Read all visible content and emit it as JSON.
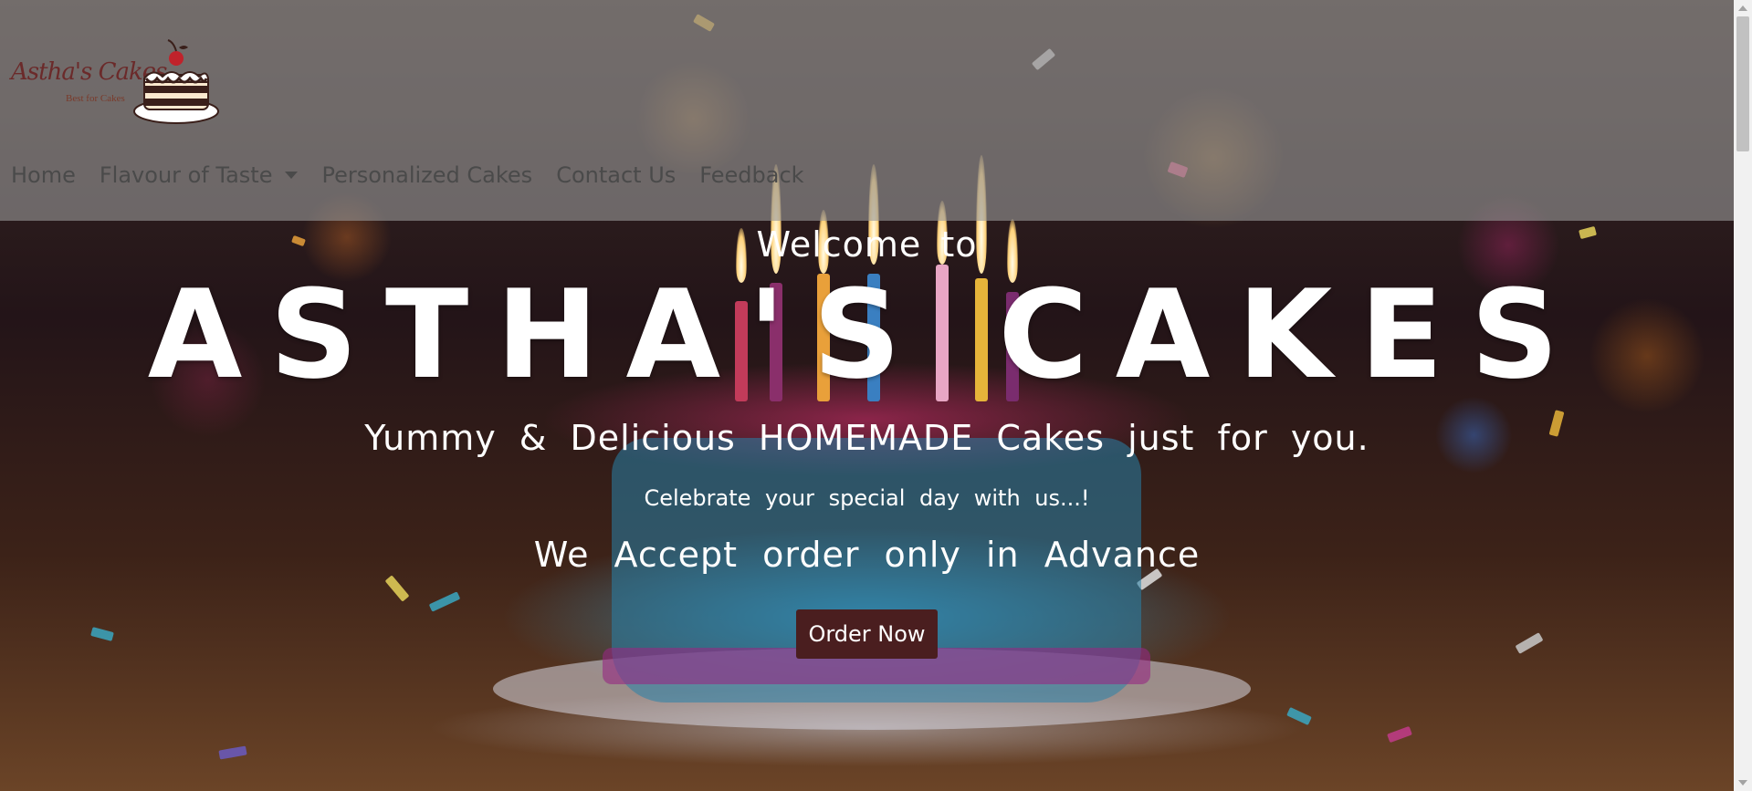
{
  "brand": {
    "logo_text": "Astha's Cakes",
    "logo_tagline": "Best for Cakes"
  },
  "nav": {
    "items": [
      {
        "label": "Home"
      },
      {
        "label": "Flavour of Taste",
        "has_dropdown": true
      },
      {
        "label": "Personalized Cakes"
      },
      {
        "label": "Contact Us"
      },
      {
        "label": "Feedback"
      }
    ]
  },
  "hero": {
    "welcome": "Welcome to",
    "title": "ASTHA'S CAKES",
    "tagline": "Yummy & Delicious HOMEMADE Cakes just for you.",
    "subtitle": "Celebrate your special day with us...!",
    "advance_note": "We Accept order only in Advance",
    "cta_label": "Order Now"
  },
  "colors": {
    "navbar_overlay": "#969696",
    "nav_text": "#4a4a4a",
    "cta_bg": "#4a1e1f",
    "hero_text": "#ffffff"
  }
}
